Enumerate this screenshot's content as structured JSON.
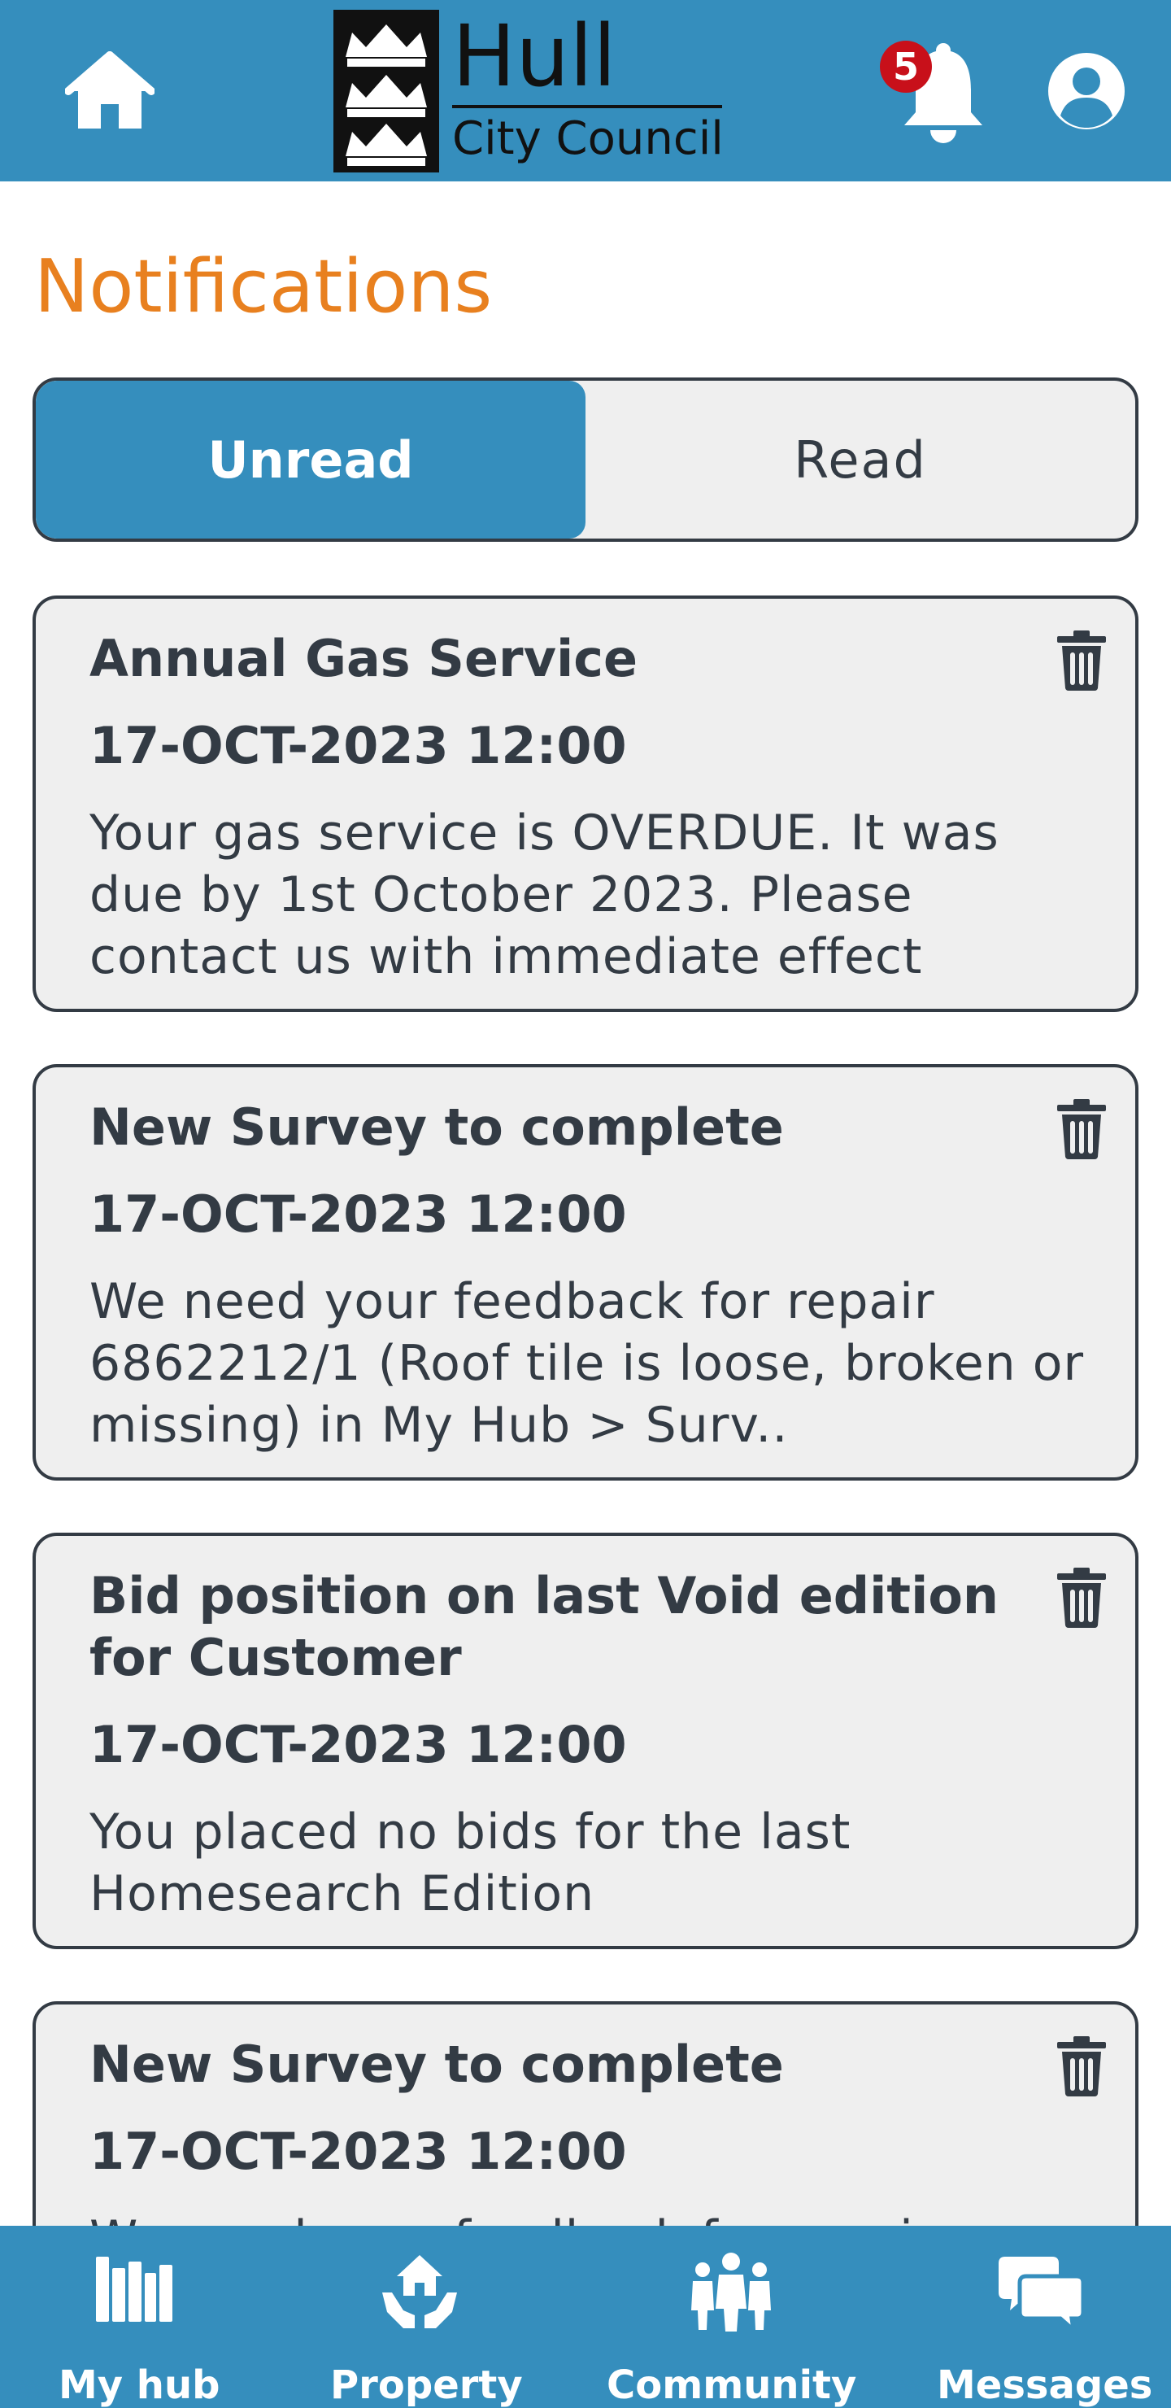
{
  "header": {
    "logo_title": "Hull",
    "logo_subtitle": "City Council",
    "notification_count": "5"
  },
  "page": {
    "title": "Notifications"
  },
  "tabs": {
    "unread": "Unread",
    "read": "Read",
    "active": "Unread"
  },
  "notifications": [
    {
      "title": "Annual Gas Service",
      "date": "17-OCT-2023 12:00",
      "body": "Your gas service is OVERDUE. It was due by 1st October 2023. Please contact us with immediate effect"
    },
    {
      "title": "New Survey to complete",
      "date": "17-OCT-2023 12:00",
      "body": "We need your feedback for repair 6862212/1 (Roof tile is loose, broken or missing) in My Hub > Surv.."
    },
    {
      "title": "Bid position on last Void edition for Customer",
      "date": "17-OCT-2023 12:00",
      "body": "You placed no bids for the last Homesearch Edition"
    },
    {
      "title": "New Survey to complete",
      "date": "17-OCT-2023 12:00",
      "body": "We need your feedback for repair"
    }
  ],
  "bottom_nav": {
    "items": [
      {
        "label": "My hub",
        "icon": "library-icon"
      },
      {
        "label": "Property",
        "icon": "house-hands-icon"
      },
      {
        "label": "Community",
        "icon": "people-icon"
      },
      {
        "label": "Messages",
        "icon": "chat-bubbles-icon"
      }
    ]
  },
  "colors": {
    "brand_blue": "#358ebd",
    "title_orange": "#e8801f",
    "badge_red": "#c8101a",
    "card_bg": "#efefef",
    "text_dark": "#333b44"
  }
}
